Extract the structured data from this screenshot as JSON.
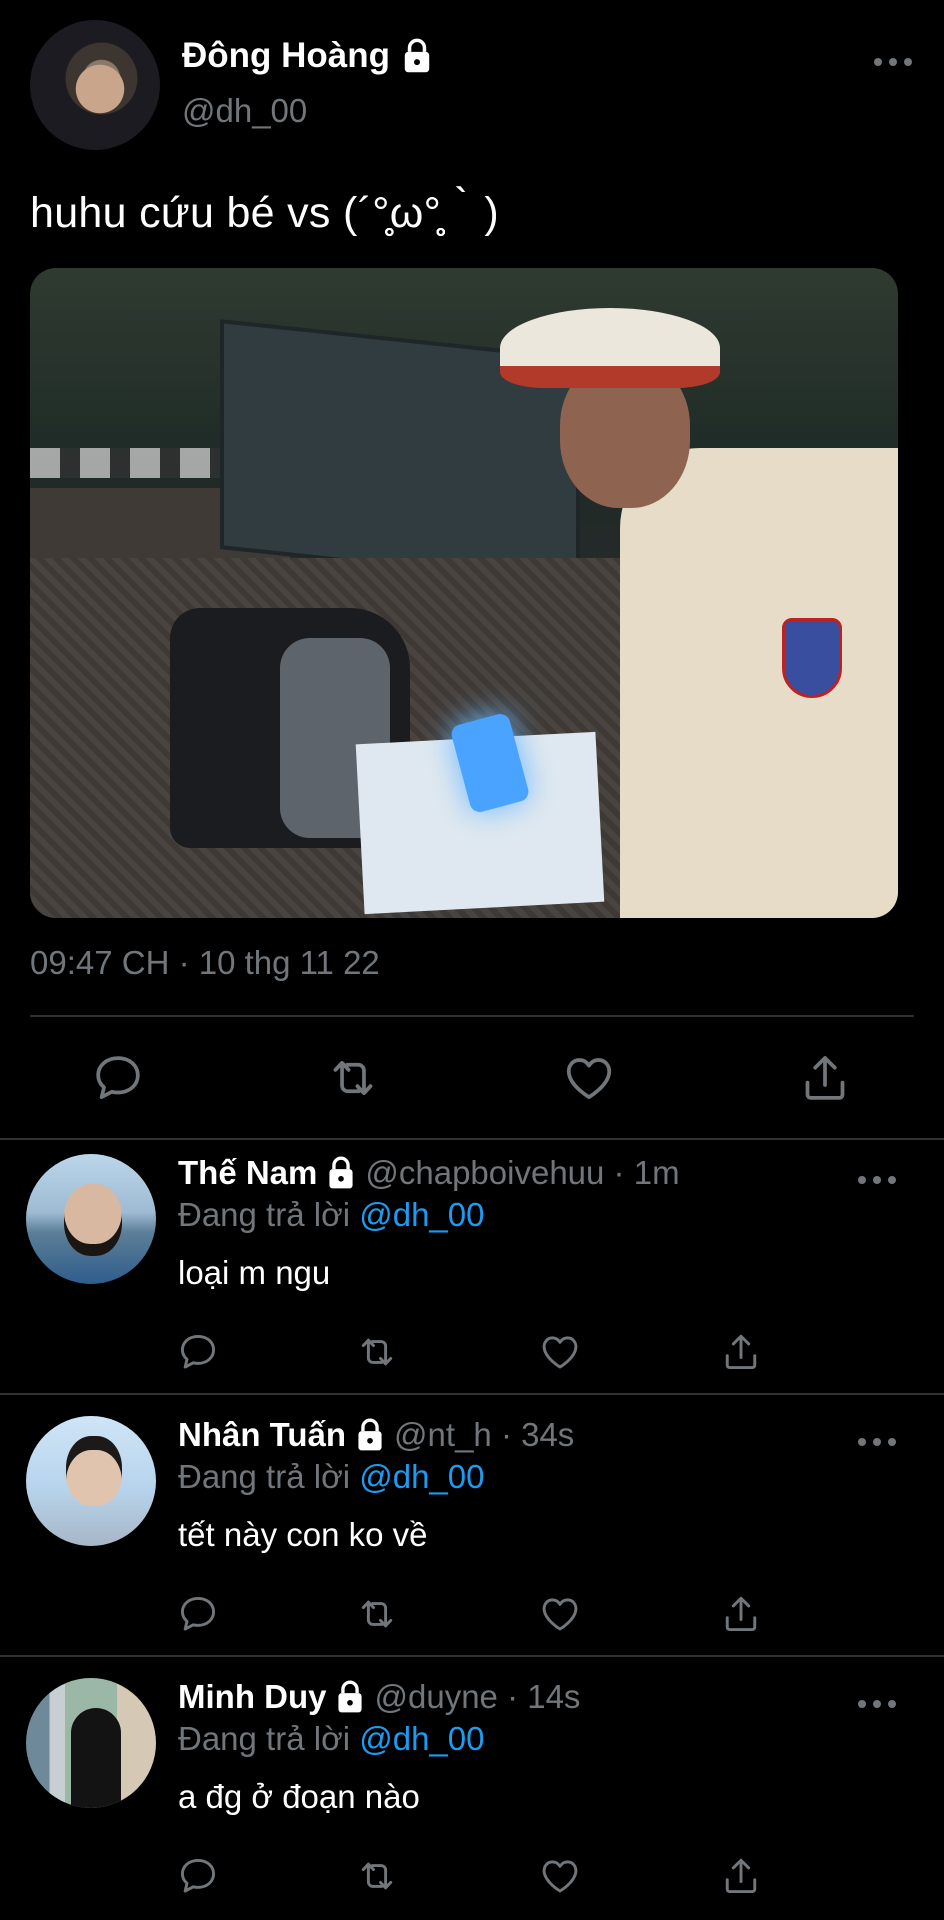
{
  "tweet": {
    "author_name": "Đông Hoàng",
    "author_handle": "@dh_00",
    "text": "huhu cứu bé vs (´°̥̥̥̥̥̥̥̥ω°̥̥̥̥̥̥̥̥｀)",
    "timestamp": "09:47 CH · 10 thg 11 22"
  },
  "replies": [
    {
      "name": "Thế Nam",
      "handle": "@chapboivehuu · 1m",
      "replying_prefix": "Đang trả lời ",
      "replying_to": "@dh_00",
      "text": "loại m ngu"
    },
    {
      "name": "Nhân Tuấn",
      "handle": "@nt_h · 34s",
      "replying_prefix": "Đang trả lời ",
      "replying_to": "@dh_00",
      "text": "tết này con ko về"
    },
    {
      "name": "Minh Duy",
      "handle": "@duyne · 14s",
      "replying_prefix": "Đang trả lời ",
      "replying_to": "@dh_00",
      "text": "a đg ở đoạn nào"
    }
  ],
  "icons": {
    "reply": "comment-bubble-icon",
    "retweet": "retweet-icon",
    "like": "heart-icon",
    "share": "share-upload-icon",
    "more": "more-dots-icon",
    "lock": "lock-icon"
  },
  "colors": {
    "background": "#000000",
    "text": "#e7e9ea",
    "secondary": "#71767b",
    "accent": "#1d9bf0",
    "divider": "#2f3336"
  }
}
